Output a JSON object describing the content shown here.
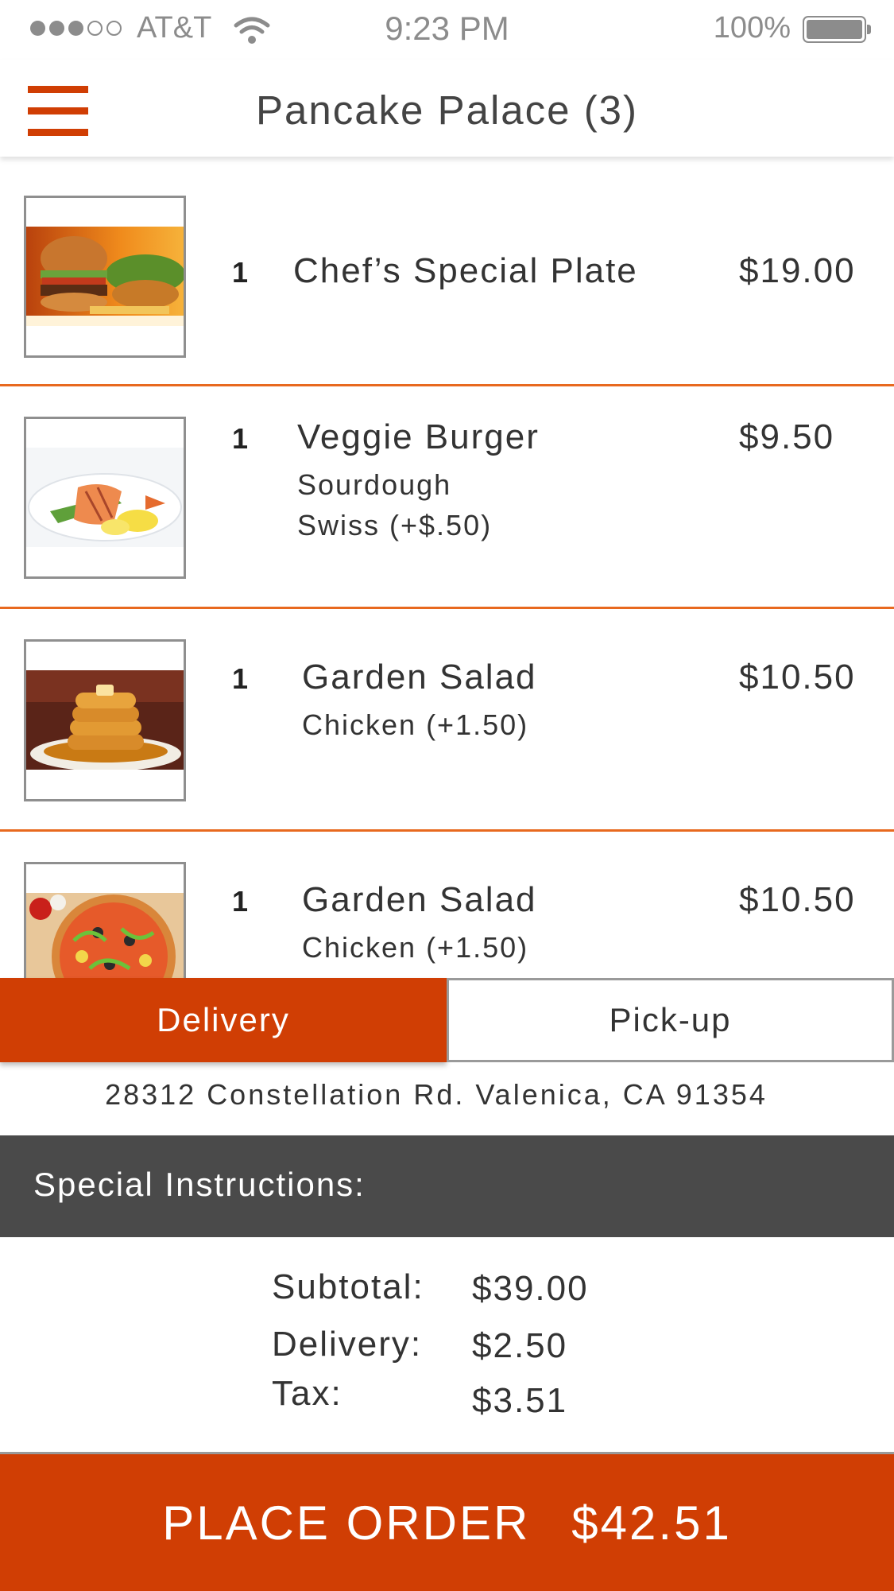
{
  "status_bar": {
    "carrier": "AT&T",
    "time": "9:23 PM",
    "battery": "100%"
  },
  "header": {
    "title": "Pancake Palace (3)",
    "menu_icon": "hamburger-menu-icon"
  },
  "cart": {
    "items": [
      {
        "qty": "1",
        "name": "Chef’s Special Plate",
        "price": "$19.00",
        "options": [],
        "image": "burger-and-fries-photo"
      },
      {
        "qty": "1",
        "name": "Veggie Burger",
        "price": "$9.50",
        "options": [
          "Sourdough",
          "Swiss (+$.50)"
        ],
        "image": "grilled-salmon-plate-photo"
      },
      {
        "qty": "1",
        "name": "Garden Salad",
        "price": "$10.50",
        "options": [
          "Chicken (+1.50)"
        ],
        "image": "pancake-stack-photo"
      },
      {
        "qty": "1",
        "name": "Garden Salad",
        "price": "$10.50",
        "options": [
          "Chicken (+1.50)"
        ],
        "image": "pizza-photo"
      }
    ]
  },
  "order_type": {
    "delivery_label": "Delivery",
    "pickup_label": "Pick-up",
    "selected": "Delivery"
  },
  "address": "28312 Constellation Rd. Valenica, CA 91354",
  "instructions": {
    "label": "Special Instructions:"
  },
  "totals": {
    "subtotal_label": "Subtotal:",
    "subtotal": "$39.00",
    "delivery_label": "Delivery:",
    "delivery": "$2.50",
    "tax_label": "Tax:",
    "tax": "$3.51"
  },
  "place_order": {
    "label": "PLACE ORDER",
    "total": "$42.51"
  },
  "colors": {
    "accent": "#d03e04",
    "divider": "#e8691f",
    "instructions_bar": "#4a4a4a"
  }
}
